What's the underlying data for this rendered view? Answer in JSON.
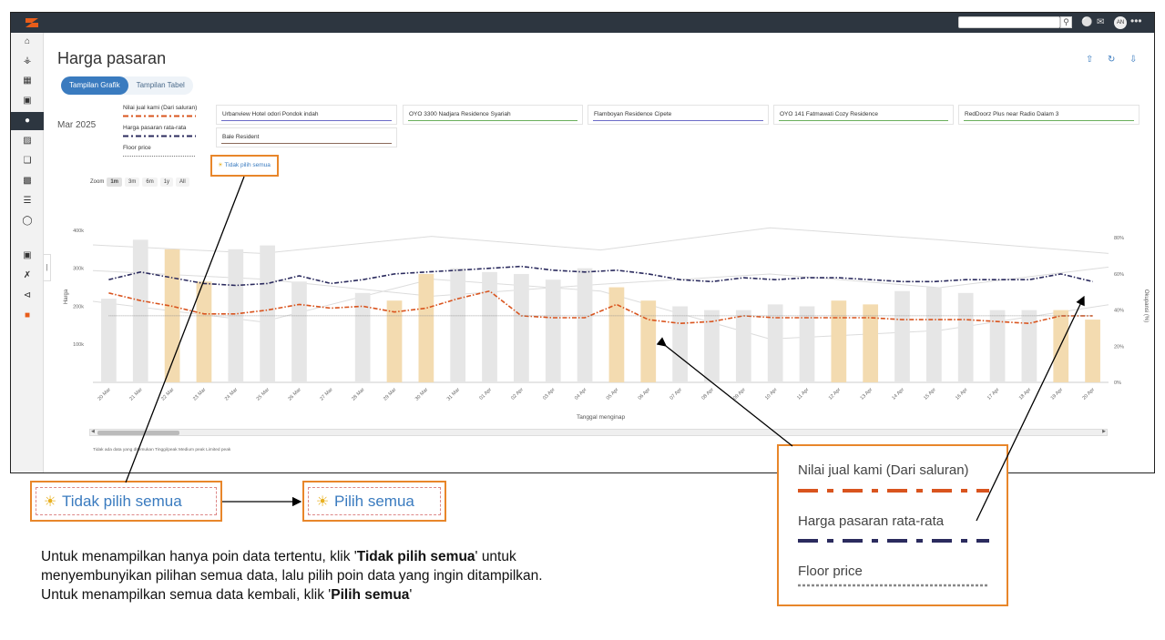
{
  "page": {
    "title": "Harga pasaran",
    "month": "Mar 2025"
  },
  "tabs": [
    {
      "label": "Tampilan Grafik",
      "active": true
    },
    {
      "label": "Tampilan Tabel",
      "active": false
    }
  ],
  "legend": {
    "our_price": "Nilai jual kami (Dari saluran)",
    "market_avg": "Harga pasaran rata-rata",
    "floor": "Floor price"
  },
  "properties": [
    {
      "name": "Urbanview Hotel odori Pondok indah",
      "color": "#6b6bc7"
    },
    {
      "name": "OYO 3300 Nadjara Residence Syariah",
      "color": "#6aaf5c"
    },
    {
      "name": "Flamboyan Residence Cipete",
      "color": "#6b6bc7"
    },
    {
      "name": "OYO 141 Fatmawati Cozy Residence",
      "color": "#6aaf5c"
    },
    {
      "name": "RedDoorz Plus near Radio Dalam 3",
      "color": "#6aaf5c"
    },
    {
      "name": "Bale Resident",
      "color": "#8a6a5a"
    }
  ],
  "deselect_label": "Tidak pilih semua",
  "select_all_label": "Pilih semua",
  "zoom": {
    "label": "Zoom",
    "options": [
      "1m",
      "3m",
      "6m",
      "1y",
      "All"
    ],
    "active": "1m"
  },
  "bottom_legend": "Tidak ada data yang ditemukan     Tinggi/peak     Medium peak     Limited peak",
  "instruction": {
    "p1": "Untuk menampilkan hanya poin data tertentu, klik '",
    "b1": "Tidak pilih semua",
    "p2": "' untuk menyembunyikan pilihan semua data, lalu pilih poin data yang ingin ditampilkan. Untuk menampilkan semua data kembali, klik '",
    "b2": "Pilih semua",
    "p3": "'"
  },
  "colors": {
    "accent": "#3a7bbf",
    "orange_line": "#d9541e",
    "navy_line": "#2b2b5e",
    "callout": "#e8862a",
    "bar_peak": "#f3dbb0",
    "bar_normal": "#e6e6e6"
  },
  "topbar": {
    "avatar": "AN"
  },
  "chart_data": {
    "type": "bar",
    "xlabel": "Tanggal menginap",
    "ylabel": "Harga",
    "y2label": "Okupansi (%)",
    "ylim": [
      0,
      450000
    ],
    "y2lim": [
      0,
      80
    ],
    "yticks": [
      "100k",
      "200k",
      "300k",
      "400k"
    ],
    "y2ticks": [
      "0%",
      "20%",
      "40%",
      "60%",
      "80%"
    ],
    "categories": [
      "20 Mar",
      "21 Mar",
      "22 Mar",
      "23 Mar",
      "24 Mar",
      "25 Mar",
      "26 Mar",
      "27 Mar",
      "28 Mar",
      "29 Mar",
      "30 Mar",
      "31 Mar",
      "01 Apr",
      "02 Apr",
      "03 Apr",
      "04 Apr",
      "05 Apr",
      "06 Apr",
      "07 Apr",
      "08 Apr",
      "09 Apr",
      "10 Apr",
      "11 Apr",
      "12 Apr",
      "13 Apr",
      "14 Apr",
      "15 Apr",
      "16 Apr",
      "17 Apr",
      "18 Apr",
      "19 Apr",
      "20 Apr"
    ],
    "bars": [
      220,
      375,
      350,
      265,
      350,
      360,
      265,
      0,
      235,
      215,
      285,
      300,
      290,
      285,
      270,
      300,
      250,
      215,
      200,
      190,
      190,
      205,
      200,
      215,
      205,
      240,
      250,
      235,
      190,
      190,
      190,
      165
    ],
    "bar_peak": [
      false,
      false,
      true,
      true,
      false,
      false,
      false,
      false,
      false,
      true,
      true,
      false,
      false,
      false,
      false,
      false,
      true,
      true,
      false,
      false,
      false,
      false,
      false,
      true,
      true,
      false,
      false,
      false,
      false,
      false,
      true,
      true
    ],
    "series": [
      {
        "name": "Nilai jual kami (Dari saluran)",
        "values": [
          235,
          215,
          200,
          180,
          180,
          190,
          205,
          195,
          200,
          185,
          195,
          220,
          240,
          175,
          170,
          170,
          205,
          165,
          155,
          160,
          175,
          170,
          170,
          170,
          170,
          165,
          165,
          165,
          160,
          155,
          175,
          175
        ]
      },
      {
        "name": "Harga pasaran rata-rata",
        "values": [
          270,
          290,
          275,
          260,
          255,
          260,
          280,
          260,
          270,
          285,
          290,
          295,
          300,
          305,
          295,
          290,
          295,
          285,
          270,
          265,
          275,
          270,
          275,
          275,
          270,
          265,
          265,
          270,
          270,
          270,
          285,
          265
        ]
      },
      {
        "name": "Floor price",
        "values": [
          175,
          175,
          175,
          175,
          175,
          175,
          175,
          175,
          175,
          175,
          175,
          175,
          175,
          175,
          175,
          175,
          175,
          175,
          175,
          175,
          175,
          175,
          175,
          175,
          175,
          175,
          175,
          175,
          175,
          175,
          175,
          175
        ]
      }
    ]
  }
}
